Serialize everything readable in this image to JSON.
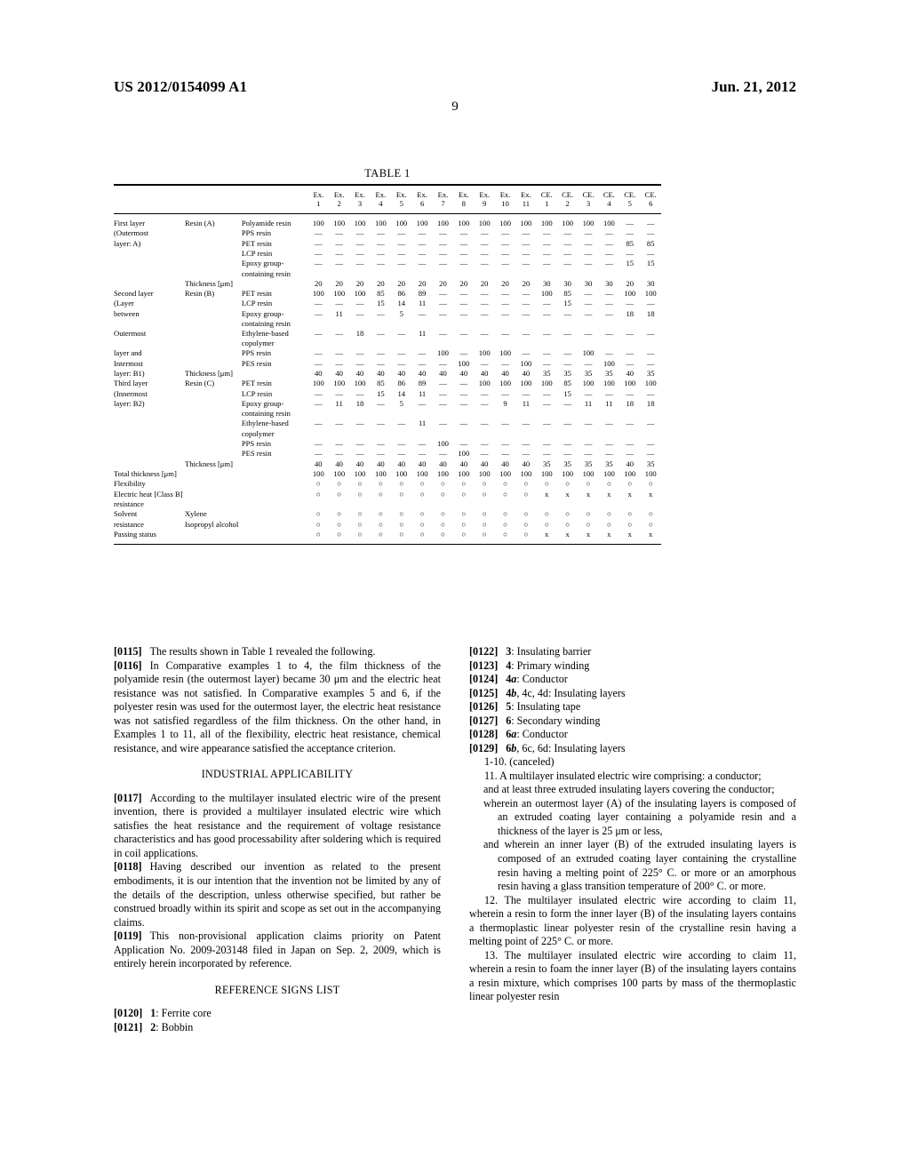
{
  "header": {
    "publication_number": "US 2012/0154099 A1",
    "publication_date": "Jun. 21, 2012",
    "page_number": "9"
  },
  "table": {
    "caption": "TABLE 1",
    "column_headers": [
      {
        "top": "Ex.",
        "bottom": "1"
      },
      {
        "top": "Ex.",
        "bottom": "2"
      },
      {
        "top": "Ex.",
        "bottom": "3"
      },
      {
        "top": "Ex.",
        "bottom": "4"
      },
      {
        "top": "Ex.",
        "bottom": "5"
      },
      {
        "top": "Ex.",
        "bottom": "6"
      },
      {
        "top": "Ex.",
        "bottom": "7"
      },
      {
        "top": "Ex.",
        "bottom": "8"
      },
      {
        "top": "Ex.",
        "bottom": "9"
      },
      {
        "top": "Ex.",
        "bottom": "10"
      },
      {
        "top": "Ex.",
        "bottom": "11"
      },
      {
        "top": "CE.",
        "bottom": "1"
      },
      {
        "top": "CE.",
        "bottom": "2"
      },
      {
        "top": "CE.",
        "bottom": "3"
      },
      {
        "top": "CE.",
        "bottom": "4"
      },
      {
        "top": "CE.",
        "bottom": "5"
      },
      {
        "top": "CE.",
        "bottom": "6"
      }
    ],
    "rows": [
      {
        "label1": "First layer",
        "label2": "Resin (A)",
        "label3": "Polyamide resin",
        "values": [
          "100",
          "100",
          "100",
          "100",
          "100",
          "100",
          "100",
          "100",
          "100",
          "100",
          "100",
          "100",
          "100",
          "100",
          "100",
          "—",
          "—"
        ]
      },
      {
        "label1": "(Outermost",
        "label2": "",
        "label3": "PPS resin",
        "values": [
          "—",
          "—",
          "—",
          "—",
          "—",
          "—",
          "—",
          "—",
          "—",
          "—",
          "—",
          "—",
          "—",
          "—",
          "—",
          "—",
          "—"
        ]
      },
      {
        "label1": "layer: A)",
        "label2": "",
        "label3": "PET resin",
        "values": [
          "—",
          "—",
          "—",
          "—",
          "—",
          "—",
          "—",
          "—",
          "—",
          "—",
          "—",
          "—",
          "—",
          "—",
          "—",
          "85",
          "85"
        ]
      },
      {
        "label1": "",
        "label2": "",
        "label3": "LCP resin",
        "values": [
          "—",
          "—",
          "—",
          "—",
          "—",
          "—",
          "—",
          "—",
          "—",
          "—",
          "—",
          "—",
          "—",
          "—",
          "—",
          "—",
          "—"
        ]
      },
      {
        "label1": "",
        "label2": "",
        "label3": "Epoxy group-containing resin",
        "values": [
          "—",
          "—",
          "—",
          "—",
          "—",
          "—",
          "—",
          "—",
          "—",
          "—",
          "—",
          "—",
          "—",
          "—",
          "—",
          "15",
          "15"
        ]
      },
      {
        "label1": "",
        "label2": "Thickness [μm]",
        "label3": "",
        "values": [
          "20",
          "20",
          "20",
          "20",
          "20",
          "20",
          "20",
          "20",
          "20",
          "20",
          "20",
          "30",
          "30",
          "30",
          "30",
          "20",
          "30"
        ]
      },
      {
        "label1": "Second layer",
        "label2": "Resin (B)",
        "label3": "PET resin",
        "values": [
          "100",
          "100",
          "100",
          "85",
          "86",
          "89",
          "—",
          "—",
          "—",
          "—",
          "—",
          "100",
          "85",
          "—",
          "—",
          "100",
          "100"
        ]
      },
      {
        "label1": "(Layer",
        "label2": "",
        "label3": "LCP resin",
        "values": [
          "—",
          "—",
          "—",
          "15",
          "14",
          "11",
          "—",
          "—",
          "—",
          "—",
          "—",
          "—",
          "15",
          "—",
          "—",
          "—",
          "—"
        ]
      },
      {
        "label1": "between",
        "label2": "",
        "label3": "Epoxy group-containing resin",
        "values": [
          "—",
          "11",
          "—",
          "—",
          "5",
          "—",
          "—",
          "—",
          "—",
          "—",
          "—",
          "—",
          "—",
          "—",
          "—",
          "18",
          "18"
        ]
      },
      {
        "label1": "Outermost",
        "label2": "",
        "label3": "Ethylene-based copolymer",
        "values": [
          "—",
          "—",
          "18",
          "—",
          "—",
          "11",
          "—",
          "—",
          "—",
          "—",
          "—",
          "—",
          "—",
          "—",
          "—",
          "—",
          "—"
        ]
      },
      {
        "label1": "layer and",
        "label2": "",
        "label3": "PPS resin",
        "values": [
          "—",
          "—",
          "—",
          "—",
          "—",
          "—",
          "100",
          "—",
          "100",
          "100",
          "—",
          "—",
          "—",
          "100",
          "—",
          "—",
          "—"
        ]
      },
      {
        "label1": "Intermost",
        "label2": "",
        "label3": "PES resin",
        "values": [
          "—",
          "—",
          "—",
          "—",
          "—",
          "—",
          "—",
          "100",
          "—",
          "—",
          "100",
          "—",
          "—",
          "—",
          "100",
          "—",
          "—"
        ]
      },
      {
        "label1": "layer: B1)",
        "label2": "Thickness [μm]",
        "label3": "",
        "values": [
          "40",
          "40",
          "40",
          "40",
          "40",
          "40",
          "40",
          "40",
          "40",
          "40",
          "40",
          "35",
          "35",
          "35",
          "35",
          "40",
          "35"
        ]
      },
      {
        "label1": "Third layer",
        "label2": "Resin (C)",
        "label3": "PET resin",
        "values": [
          "100",
          "100",
          "100",
          "85",
          "86",
          "89",
          "—",
          "—",
          "100",
          "100",
          "100",
          "100",
          "85",
          "100",
          "100",
          "100",
          "100"
        ]
      },
      {
        "label1": "(Innermost",
        "label2": "",
        "label3": "LCP resin",
        "values": [
          "—",
          "—",
          "—",
          "15",
          "14",
          "11",
          "—",
          "—",
          "—",
          "—",
          "—",
          "—",
          "15",
          "—",
          "—",
          "—",
          "—"
        ]
      },
      {
        "label1": "layer: B2)",
        "label2": "",
        "label3": "Epoxy group-containing resin",
        "values": [
          "—",
          "11",
          "18",
          "—",
          "5",
          "—",
          "—",
          "—",
          "—",
          "9",
          "11",
          "—",
          "—",
          "11",
          "11",
          "18",
          "18"
        ]
      },
      {
        "label1": "",
        "label2": "",
        "label3": "Ethylene-based copolymer",
        "values": [
          "—",
          "—",
          "—",
          "—",
          "—",
          "11",
          "—",
          "—",
          "—",
          "—",
          "—",
          "—",
          "—",
          "—",
          "—",
          "—",
          "—"
        ]
      },
      {
        "label1": "",
        "label2": "",
        "label3": "PPS resin",
        "values": [
          "—",
          "—",
          "—",
          "—",
          "—",
          "—",
          "100",
          "—",
          "—",
          "—",
          "—",
          "—",
          "—",
          "—",
          "—",
          "—",
          "—"
        ]
      },
      {
        "label1": "",
        "label2": "",
        "label3": "PES resin",
        "values": [
          "—",
          "—",
          "—",
          "—",
          "—",
          "—",
          "—",
          "100",
          "—",
          "—",
          "—",
          "—",
          "—",
          "—",
          "—",
          "—",
          "—"
        ]
      },
      {
        "label1": "",
        "label2": "Thickness [μm]",
        "label3": "",
        "values": [
          "40",
          "40",
          "40",
          "40",
          "40",
          "40",
          "40",
          "40",
          "40",
          "40",
          "40",
          "35",
          "35",
          "35",
          "35",
          "40",
          "35"
        ]
      },
      {
        "label1": "Total thickness [μm]",
        "label2": "",
        "label3": "",
        "values": [
          "100",
          "100",
          "100",
          "100",
          "100",
          "100",
          "100",
          "100",
          "100",
          "100",
          "100",
          "100",
          "100",
          "100",
          "100",
          "100",
          "100"
        ]
      },
      {
        "label1": "Flexibility",
        "label2": "",
        "label3": "",
        "values": [
          "○",
          "○",
          "○",
          "○",
          "○",
          "○",
          "○",
          "○",
          "○",
          "○",
          "○",
          "○",
          "○",
          "○",
          "○",
          "○",
          "○"
        ]
      },
      {
        "label1": "Electric heat [Class B]",
        "label2": "",
        "label3": "",
        "values": [
          "○",
          "○",
          "○",
          "○",
          "○",
          "○",
          "○",
          "○",
          "○",
          "○",
          "○",
          "x",
          "x",
          "x",
          "x",
          "x",
          "x"
        ]
      },
      {
        "label1": "resistance",
        "label2": "",
        "label3": "",
        "values": [
          "",
          "",
          "",
          "",
          "",
          "",
          "",
          "",
          "",
          "",
          "",
          "",
          "",
          "",
          "",
          "",
          ""
        ]
      },
      {
        "label1": "Solvent",
        "label2": "Xylene",
        "label3": "",
        "values": [
          "○",
          "○",
          "○",
          "○",
          "○",
          "○",
          "○",
          "○",
          "○",
          "○",
          "○",
          "○",
          "○",
          "○",
          "○",
          "○",
          "○"
        ]
      },
      {
        "label1": "resistance",
        "label2": "Isopropyl alcohol",
        "label3": "",
        "values": [
          "○",
          "○",
          "○",
          "○",
          "○",
          "○",
          "○",
          "○",
          "○",
          "○",
          "○",
          "○",
          "○",
          "○",
          "○",
          "○",
          "○"
        ]
      },
      {
        "label1": "Passing status",
        "label2": "",
        "label3": "",
        "values": [
          "○",
          "○",
          "○",
          "○",
          "○",
          "○",
          "○",
          "○",
          "○",
          "○",
          "○",
          "x",
          "x",
          "x",
          "x",
          "x",
          "x"
        ]
      }
    ]
  },
  "left_column": {
    "para_0115_num": "[0115]",
    "para_0115_text": "The results shown in Table 1 revealed the following.",
    "para_0116_num": "[0116]",
    "para_0116_text": "In Comparative examples 1 to 4, the film thickness of the polyamide resin (the outermost layer) became 30 μm and the electric heat resistance was not satisfied. In Comparative examples 5 and 6, if the polyester resin was used for the outermost layer, the electric heat resistance was not satisfied regardless of the film thickness. On the other hand, in Examples 1 to 11, all of the flexibility, electric heat resistance, chemical resistance, and wire appearance satisfied the acceptance criterion.",
    "heading_industrial": "INDUSTRIAL APPLICABILITY",
    "para_0117_num": "[0117]",
    "para_0117_text": "According to the multilayer insulated electric wire of the present invention, there is provided a multilayer insulated electric wire which satisfies the heat resistance and the requirement of voltage resistance characteristics and has good processability after soldering which is required in coil applications.",
    "para_0118_num": "[0118]",
    "para_0118_text": "Having described our invention as related to the present embodiments, it is our intention that the invention not be limited by any of the details of the description, unless otherwise specified, but rather be construed broadly within its spirit and scope as set out in the accompanying claims.",
    "para_0119_num": "[0119]",
    "para_0119_text": "This non-provisional application claims priority on Patent Application No. 2009-203148 filed in Japan on Sep. 2, 2009, which is entirely herein incorporated by reference.",
    "heading_reference": "REFERENCE SIGNS LIST",
    "refs": [
      {
        "num": "[0120]",
        "sign": "1",
        "suffix": "",
        "desc": ": Ferrite core"
      },
      {
        "num": "[0121]",
        "sign": "2",
        "suffix": "",
        "desc": ": Bobbin"
      }
    ]
  },
  "right_column": {
    "refs": [
      {
        "num": "[0122]",
        "sign": "3",
        "suffix": "",
        "desc": ": Insulating barrier"
      },
      {
        "num": "[0123]",
        "sign": "4",
        "suffix": "",
        "desc": ": Primary winding"
      },
      {
        "num": "[0124]",
        "sign": "4",
        "suffix": "a",
        "desc": ": Conductor"
      },
      {
        "num": "[0125]",
        "sign": "4",
        "suffix": "b",
        "desc": ", 4c, 4d: Insulating layers"
      },
      {
        "num": "[0126]",
        "sign": "5",
        "suffix": "",
        "desc": ": Insulating tape"
      },
      {
        "num": "[0127]",
        "sign": "6",
        "suffix": "",
        "desc": ": Secondary winding"
      },
      {
        "num": "[0128]",
        "sign": "6",
        "suffix": "a",
        "desc": ": Conductor"
      },
      {
        "num": "[0129]",
        "sign": "6",
        "suffix": "b",
        "desc": ", 6c, 6d: Insulating layers"
      }
    ],
    "claims_canceled": "1-10. (canceled)",
    "claim11_lead": "11. A multilayer insulated electric wire comprising: a conductor;",
    "claim11_sub1": "and at least three extruded insulating layers covering the conductor;",
    "claim11_sub2": "wherein an outermost layer (A) of the insulating layers is composed of an extruded coating layer containing a polyamide resin and a thickness of the layer is 25 μm or less,",
    "claim11_sub3": "and wherein an inner layer (B) of the extruded insulating layers is composed of an extruded coating layer containing the crystalline resin having a melting point of 225° C. or more or an amorphous resin having a glass transition temperature of 200° C. or more.",
    "claim12": "12. The multilayer insulated electric wire according to claim 11, wherein a resin to form the inner layer (B) of the insulating layers contains a thermoplastic linear polyester resin of the crystalline resin having a melting point of 225° C. or more.",
    "claim13": "13. The multilayer insulated electric wire according to claim 11, wherein a resin to foam the inner layer (B) of the insulating layers contains a resin mixture, which comprises 100 parts by mass of the thermoplastic linear polyester resin"
  }
}
